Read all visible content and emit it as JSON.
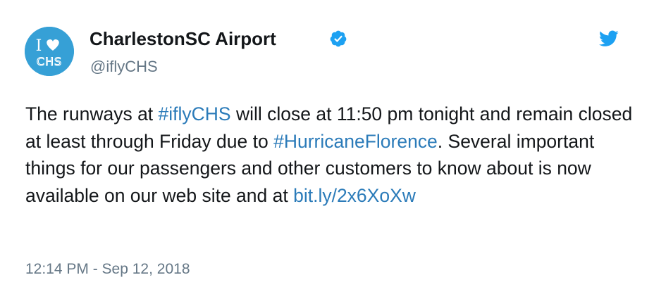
{
  "author": {
    "display_name": "CharlestonSC Airport",
    "handle": "@iflyCHS",
    "avatar_text_top": "I",
    "avatar_text_bottom": "CHS"
  },
  "icons": {
    "verified": "verified-badge-icon",
    "platform": "twitter-bird-icon",
    "avatar_heart": "heart-icon"
  },
  "tweet": {
    "segments": {
      "s1": "The runways at ",
      "hashtag1": "#iflyCHS",
      "s2": " will close at 11:50 pm tonight and remain closed at least through Friday due to ",
      "hashtag2": "#HurricaneFlorence",
      "s3": ". Several important things for our passengers and other customers to know about is now available on our web site and at ",
      "link": "bit.ly/2x6XoXw"
    },
    "timestamp": "12:14 PM - Sep 12, 2018"
  },
  "colors": {
    "link": "#2b7bb9",
    "text": "#14171a",
    "secondary": "#657786",
    "verified": "#1da1f2",
    "avatar_bg": "#36a0d6"
  }
}
